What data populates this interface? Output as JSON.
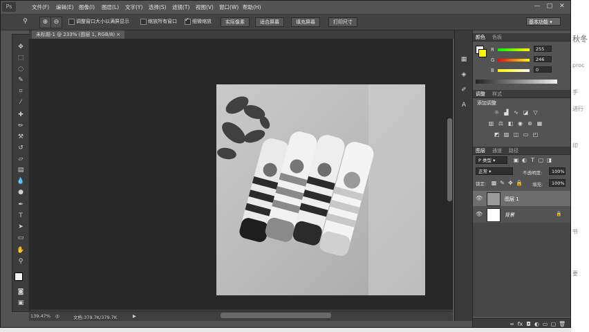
{
  "menu": {
    "logo": "Ps",
    "items": [
      "文件(F)",
      "编辑(E)",
      "图像(I)",
      "图层(L)",
      "文字(Y)",
      "选择(S)",
      "滤镜(T)",
      "视图(V)",
      "窗口(W)",
      "帮助(H)"
    ]
  },
  "window_controls": {
    "minimize": "—",
    "maximize": "□",
    "close": "✕"
  },
  "options": {
    "zoom_icon": "magnifier-icon",
    "cb1": "调整窗口大小以满屏显示",
    "cb2": "缩放所有窗口",
    "cb3": "细微缩放",
    "btn1": "实际像素",
    "btn2": "适合屏幕",
    "btn3": "填充屏幕",
    "btn4": "打印尺寸",
    "workspace": "基本功能"
  },
  "document": {
    "tab_title": "未标题-1 @ 233% (图层 1, RGB/8)",
    "close": "×"
  },
  "status": {
    "zoom": "139.47%",
    "doc_size": "文档:379.7K/379.7K"
  },
  "color_panel": {
    "tab_active": "颜色",
    "tab2": "色板",
    "r_label": "R",
    "g_label": "G",
    "b_label": "B",
    "r_value": "255",
    "g_value": "246",
    "b_value": "0"
  },
  "adjustments_panel": {
    "tab_active": "调整",
    "tab2": "样式",
    "title": "添加调整"
  },
  "layers_panel": {
    "tab_active": "图层",
    "tab2": "通道",
    "tab3": "路径",
    "filter_kind": "P 类型",
    "blend_mode": "正常",
    "opacity_label": "不透明度:",
    "opacity_value": "100%",
    "lock_label": "锁定:",
    "fill_label": "填充:",
    "fill_value": "100%",
    "layers": [
      {
        "name": "图层 1"
      },
      {
        "name": "背景"
      }
    ]
  },
  "bg_window_text": [
    "秋冬",
    "proc",
    "手",
    "进行",
    "印",
    "节",
    "要"
  ],
  "colors": {
    "accent": "#fff600",
    "app_bg": "#535353",
    "canvas_bg": "#282828"
  }
}
